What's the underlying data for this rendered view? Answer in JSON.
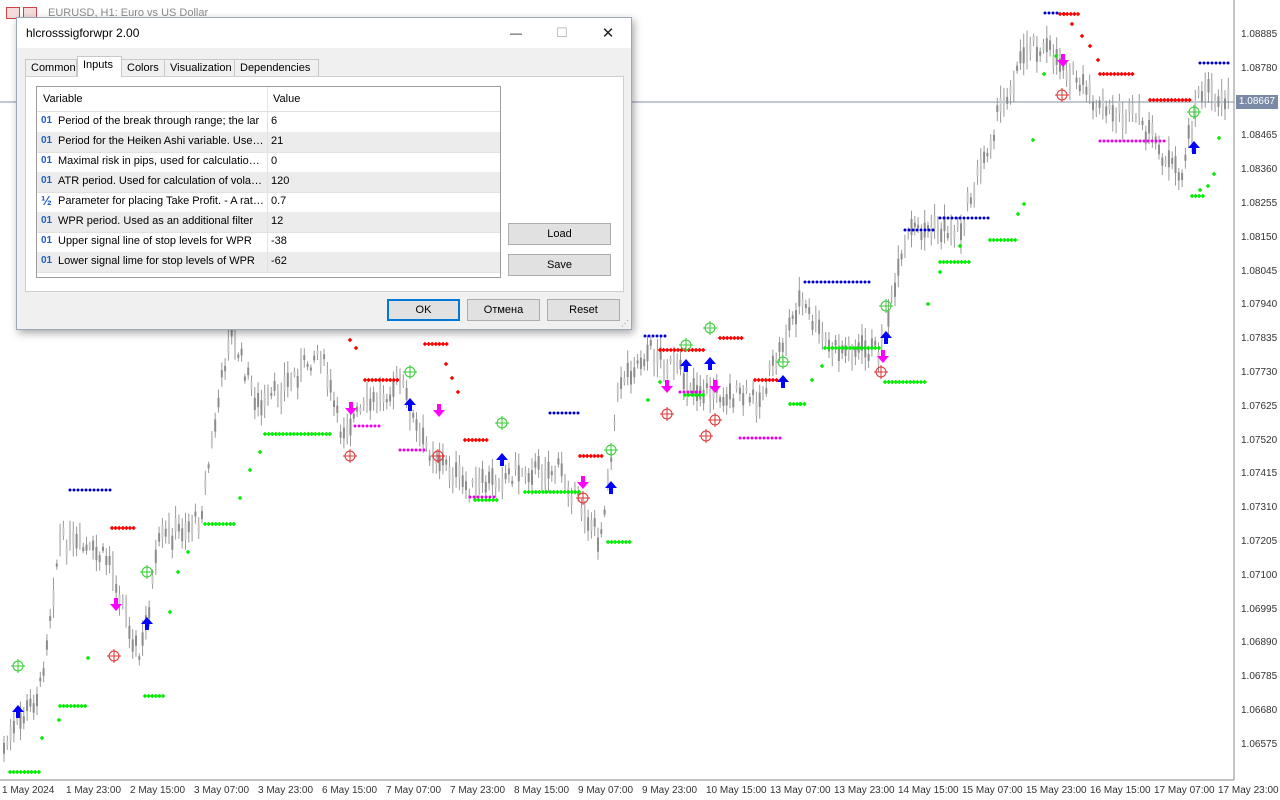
{
  "chart": {
    "title": "EURUSD, H1:  Euro vs US Dollar",
    "price_badge": "1.08667",
    "price_axis": [
      "1.08885",
      "1.08780",
      "1.08570",
      "1.08465",
      "1.08360",
      "1.08255",
      "1.08150",
      "1.08045",
      "1.07940",
      "1.07835",
      "1.07730",
      "1.07625",
      "1.07520",
      "1.07415",
      "1.07310",
      "1.07205",
      "1.07100",
      "1.06995",
      "1.06890",
      "1.06785",
      "1.06680",
      "1.06575"
    ],
    "time_axis": [
      "1 May 2024",
      "1 May 23:00",
      "2 May 15:00",
      "3 May 07:00",
      "3 May 23:00",
      "6 May 15:00",
      "7 May 07:00",
      "7 May 23:00",
      "8 May 15:00",
      "9 May 07:00",
      "9 May 23:00",
      "10 May 15:00",
      "13 May 07:00",
      "13 May 23:00",
      "14 May 15:00",
      "15 May 07:00",
      "15 May 23:00",
      "16 May 15:00",
      "17 May 07:00",
      "17 May 23:00"
    ],
    "colors": {
      "bull": "#ffffff",
      "bear": "#8c8c8c",
      "resistance": "#ff0000",
      "support": "#00ee00",
      "upper_dots": "#0000cc",
      "lower_dots": "#ee00ee",
      "buy_arrow": "#0000ff",
      "sell_arrow": "#ff00ff"
    }
  },
  "dialog": {
    "title": "hlcrosssigforwpr 2.00",
    "minimize_icon": "—",
    "maximize_icon": "☐",
    "close_icon": "✕",
    "tabs": [
      {
        "label": "Common"
      },
      {
        "label": "Inputs"
      },
      {
        "label": "Colors"
      },
      {
        "label": "Visualization"
      },
      {
        "label": "Dependencies"
      }
    ],
    "grid": {
      "col_variable": "Variable",
      "col_value": "Value",
      "rows": [
        {
          "icon": "01",
          "variable": "Period of the break through range; the lar",
          "value": "6"
        },
        {
          "icon": "01",
          "variable": "Period for the Heiken Ashi variable. Used as",
          "value": "21"
        },
        {
          "icon": "01",
          "variable": "Maximal risk in pips, used for calculation of",
          "value": "0"
        },
        {
          "icon": "01",
          "variable": "ATR period. Used for calculation of volatility",
          "value": "120"
        },
        {
          "icon": "½",
          "variable": "Parameter for placing Take Profit. - A ratio of",
          "value": "0.7"
        },
        {
          "icon": "01",
          "variable": "WPR period. Used as an additional filter",
          "value": "12"
        },
        {
          "icon": "01",
          "variable": "Upper signal line of stop levels for WPR",
          "value": "-38"
        },
        {
          "icon": "01",
          "variable": "Lower signal lime for stop levels of WPR",
          "value": "-62"
        }
      ]
    },
    "load_label": "Load",
    "save_label": "Save",
    "ok_label": "OK",
    "cancel_label": "Отмена",
    "reset_label": "Reset"
  }
}
